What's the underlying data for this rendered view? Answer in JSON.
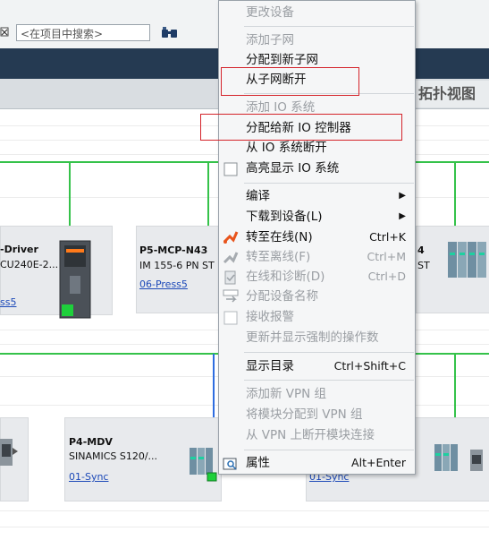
{
  "toolbar": {
    "search_placeholder": "<在项目中搜索>"
  },
  "topology_tab": "拓扑视图",
  "devices": [
    {
      "title": "-Driver",
      "subtitle": "CU240E-2...",
      "link": "ss5"
    },
    {
      "title": "P5-MCP-N43",
      "subtitle": "IM 155-6 PN ST",
      "link": "06-Press5"
    },
    {
      "title": "4",
      "subtitle": "ST",
      "link": ""
    },
    {
      "title": "P4-MDV",
      "subtitle": "SINAMICS S120/...",
      "link": "01-Sync"
    },
    {
      "title": "",
      "subtitle": "",
      "link": "01-Sync"
    }
  ],
  "context_menu": {
    "items": [
      {
        "label": "更改设备",
        "disabled": true
      },
      {
        "label": "添加子网",
        "disabled": true
      },
      {
        "label": "分配到新子网",
        "disabled": false
      },
      {
        "label": "从子网断开",
        "disabled": false
      },
      {
        "label": "添加 IO 系统",
        "disabled": true
      },
      {
        "label": "分配给新 IO 控制器",
        "disabled": false
      },
      {
        "label": "从 IO 系统断开",
        "disabled": false
      },
      {
        "label": "高亮显示 IO 系统",
        "disabled": false
      },
      {
        "label": "编译",
        "disabled": false
      },
      {
        "label": "下载到设备(L)",
        "disabled": false
      },
      {
        "label": "转至在线(N)",
        "shortcut": "Ctrl+K",
        "disabled": false
      },
      {
        "label": "转至离线(F)",
        "shortcut": "Ctrl+M",
        "disabled": true
      },
      {
        "label": "在线和诊断(D)",
        "shortcut": "Ctrl+D",
        "disabled": true
      },
      {
        "label": "分配设备名称",
        "disabled": true
      },
      {
        "label": "接收报警",
        "disabled": true
      },
      {
        "label": "更新并显示强制的操作数",
        "disabled": true
      },
      {
        "label": "显示目录",
        "shortcut": "Ctrl+Shift+C",
        "disabled": false
      },
      {
        "label": "添加新 VPN 组",
        "disabled": true
      },
      {
        "label": "将模块分配到 VPN 组",
        "disabled": true
      },
      {
        "label": "从 VPN 上断开模块连接",
        "disabled": true
      },
      {
        "label": "属性",
        "shortcut": "Alt+Enter",
        "disabled": false
      }
    ]
  },
  "icons": {
    "go_online": "go-online-icon",
    "go_offline": "go-offline-icon",
    "diagnostics": "diagnostics-icon",
    "assign_name": "assign-name-icon",
    "receive_alarms": "receive-alarms-icon",
    "properties": "properties-icon",
    "highlight": "checkbox-icon"
  },
  "colors": {
    "profinet_green": "#35c24a",
    "io_blue": "#2e6de0",
    "highlight_red": "#d4232a",
    "header_dark": "#253a52"
  }
}
